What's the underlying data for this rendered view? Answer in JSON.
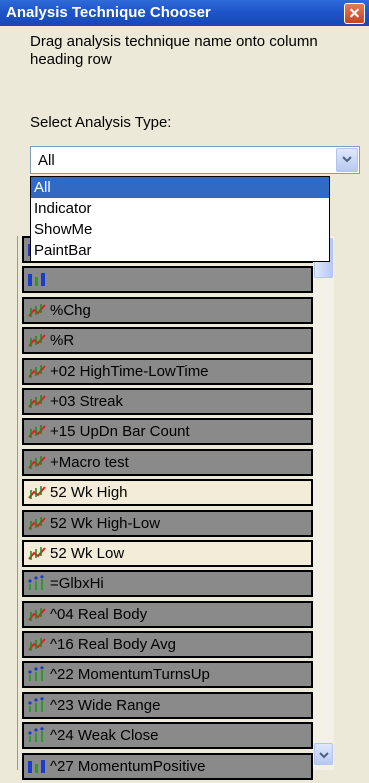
{
  "window": {
    "title": "Analysis Technique Chooser"
  },
  "instructions": "Drag analysis technique name onto column heading row",
  "select_label": "Select Analysis Type:",
  "combo": {
    "value": "All"
  },
  "dropdown_options": [
    "All",
    "Indicator",
    "ShowMe",
    "PaintBar"
  ],
  "colors": {
    "selected_bg": "#316ac5",
    "indicator_icon": "#e02020",
    "showme_icon": "#1a3cc8",
    "paintbar_icon": "#1a3cc8",
    "row_dark": "#8a8a8a",
    "row_light": "#f2ecd8"
  },
  "items": [
    {
      "label": "",
      "icon": "paintbar-icon"
    },
    {
      "label": "",
      "icon": "paintbar-icon"
    },
    {
      "label": "%Chg",
      "icon": "indicator-icon"
    },
    {
      "label": "%R",
      "icon": "indicator-icon"
    },
    {
      "label": "+02 HighTime-LowTime",
      "icon": "indicator-icon"
    },
    {
      "label": "+03 Streak",
      "icon": "indicator-icon"
    },
    {
      "label": "+15 UpDn Bar Count",
      "icon": "indicator-icon"
    },
    {
      "label": "+Macro test",
      "icon": "indicator-icon"
    },
    {
      "label": "52 Wk High",
      "icon": "indicator-icon"
    },
    {
      "label": "52 Wk High-Low",
      "icon": "indicator-icon"
    },
    {
      "label": "52 Wk Low",
      "icon": "indicator-icon"
    },
    {
      "label": "=GlbxHi",
      "icon": "showme-icon"
    },
    {
      "label": "^04 Real Body",
      "icon": "indicator-icon"
    },
    {
      "label": "^16 Real Body Avg",
      "icon": "indicator-icon"
    },
    {
      "label": "^22 MomentumTurnsUp",
      "icon": "showme-icon"
    },
    {
      "label": "^23 Wide Range",
      "icon": "showme-icon"
    },
    {
      "label": "^24 Weak Close",
      "icon": "showme-icon"
    },
    {
      "label": "^27 MomentumPositive",
      "icon": "paintbar-icon"
    }
  ]
}
